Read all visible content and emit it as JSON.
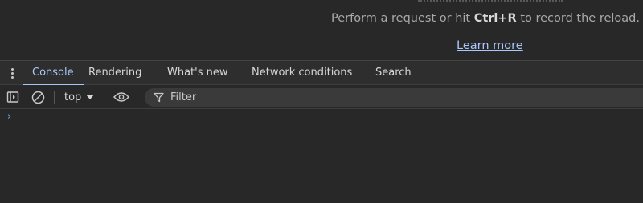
{
  "network_empty": {
    "hint_before": "Perform a request or hit ",
    "hint_shortcut": "Ctrl+R",
    "hint_after": " to record the reload.",
    "learn_more": "Learn more"
  },
  "drawer": {
    "menu_icon": "more-vertical-icon",
    "tabs": [
      {
        "label": "Console",
        "active": true
      },
      {
        "label": "Rendering",
        "active": false
      },
      {
        "label": "What's new",
        "active": false
      },
      {
        "label": "Network conditions",
        "active": false
      },
      {
        "label": "Search",
        "active": false
      }
    ]
  },
  "console_toolbar": {
    "sidebar_icon": "sidebar-toggle-icon",
    "clear_icon": "clear-console-icon",
    "context": "top",
    "eye_icon": "eye-icon",
    "filter_icon": "filter-icon",
    "filter_placeholder": "Filter"
  },
  "console": {
    "prompt_glyph": "›"
  },
  "colors": {
    "background": "#282828",
    "accent": "#a8c7fa",
    "toolbar": "#2e2e2e",
    "filter_bg": "#3a3a3a"
  }
}
